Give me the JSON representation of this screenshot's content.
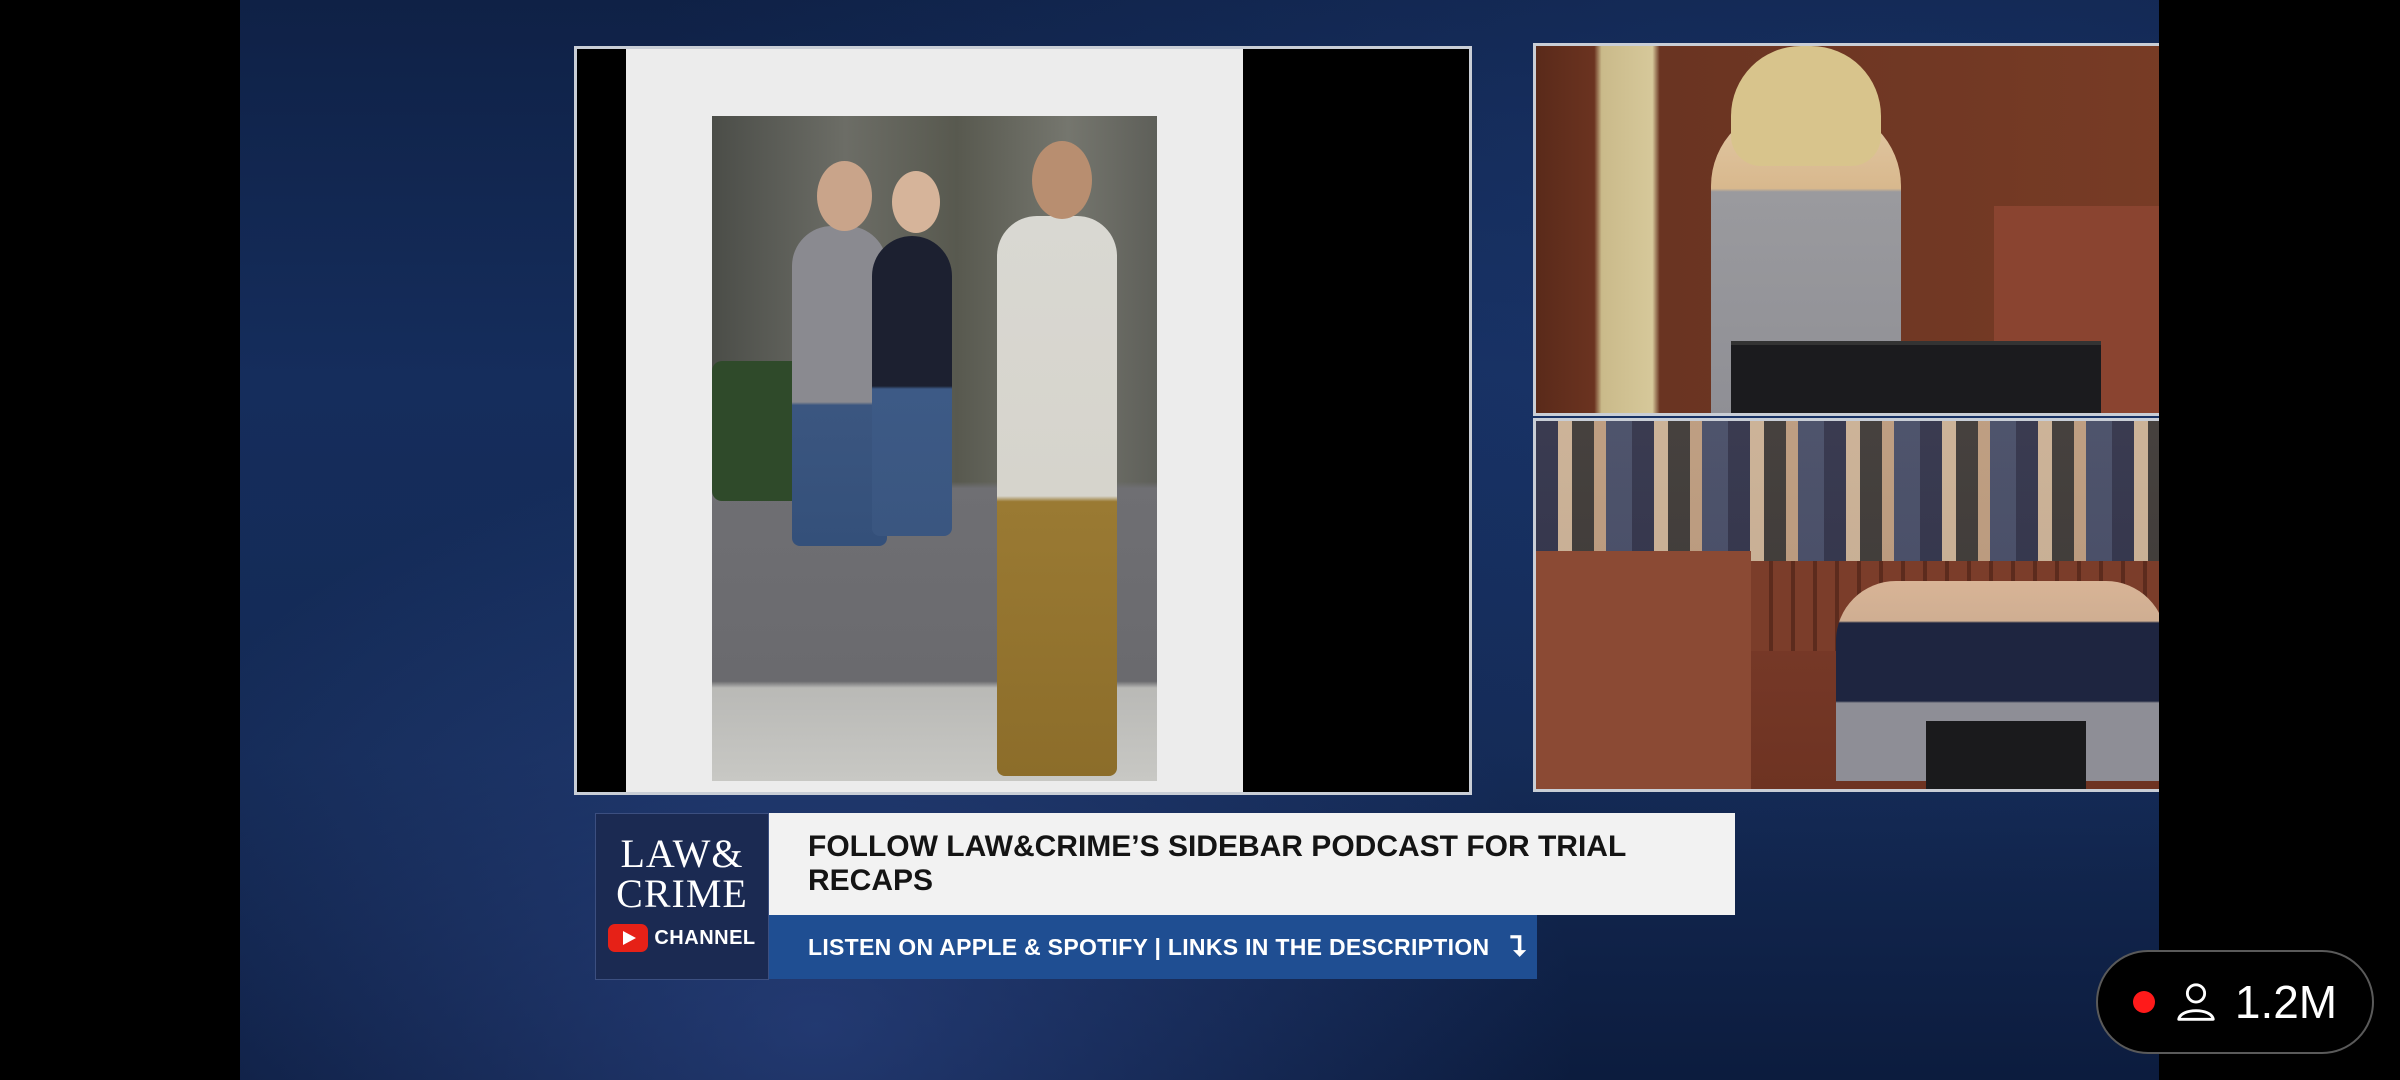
{
  "overlay": {
    "logo": {
      "line1": "LAW&",
      "line2": "CRIME",
      "channel": "CHANNEL"
    },
    "headline": "FOLLOW LAW&CRIME’S SIDEBAR PODCAST FOR TRIAL RECAPS",
    "subline": "LISTEN ON APPLE & SPOTIFY | LINKS IN THE DESCRIPTION",
    "subline_arrow": "⮧"
  },
  "live": {
    "viewer_count": "1.2M",
    "icons": [
      "live-dot",
      "person-icon"
    ]
  },
  "colors": {
    "brand_navy": "#1b2a52",
    "sub_blue": "#1f4e92",
    "live_red": "#ff1a1a",
    "youtube_red": "#e62117"
  }
}
